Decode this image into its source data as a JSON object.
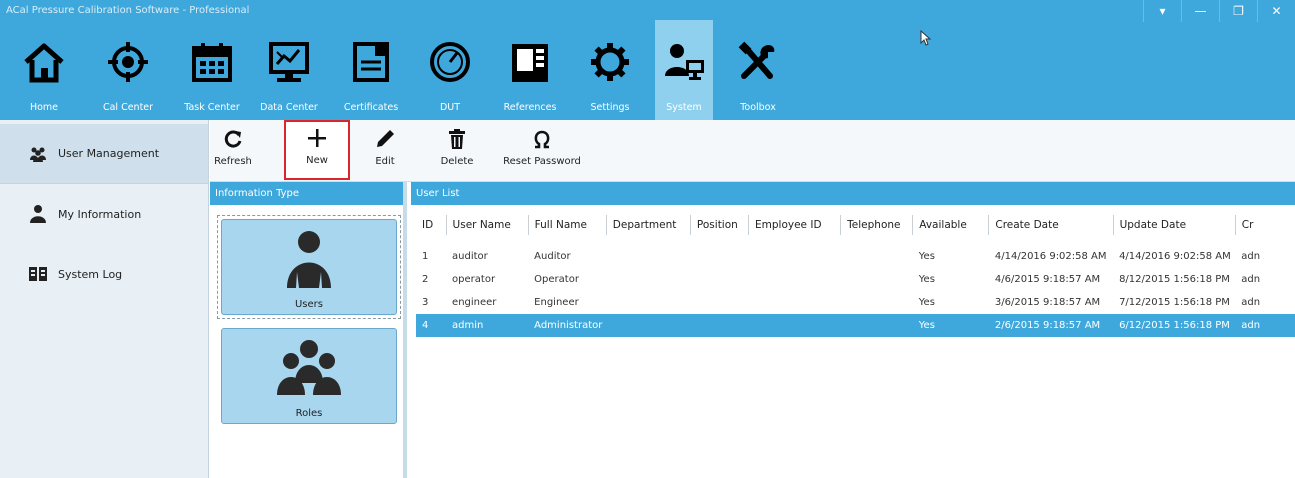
{
  "window": {
    "title": "ACal Pressure Calibration Software - Professional",
    "controls": [
      "▾",
      "—",
      "❐",
      "✕"
    ]
  },
  "nav": [
    {
      "label": "Home",
      "icon": "home-icon"
    },
    {
      "label": "Cal Center",
      "icon": "crosshair-icon"
    },
    {
      "label": "Task Center",
      "icon": "calendar-icon"
    },
    {
      "label": "Data Center",
      "icon": "chart-monitor-icon"
    },
    {
      "label": "Certificates",
      "icon": "certificate-icon"
    },
    {
      "label": "DUT",
      "icon": "gauge-icon"
    },
    {
      "label": "References",
      "icon": "reference-device-icon"
    },
    {
      "label": "Settings",
      "icon": "gear-icon"
    },
    {
      "label": "System",
      "icon": "user-computer-icon"
    },
    {
      "label": "Toolbox",
      "icon": "tools-icon"
    }
  ],
  "left_nav": [
    {
      "label": "User Management",
      "icon": "users-group-icon"
    },
    {
      "label": "My Information",
      "icon": "user-icon"
    },
    {
      "label": "System Log",
      "icon": "log-icon"
    }
  ],
  "toolbar": {
    "refresh": "Refresh",
    "new": "New",
    "edit": "Edit",
    "delete": "Delete",
    "reset_password": "Reset Password"
  },
  "info_panel": {
    "header": "Information Type",
    "users": "Users",
    "roles": "Roles"
  },
  "user_list": {
    "header": "User List",
    "columns": [
      "ID",
      "User Name",
      "Full Name",
      "Department",
      "Position",
      "Employee ID",
      "Telephone",
      "Available",
      "Create Date",
      "Update Date",
      "Cr"
    ],
    "rows": [
      [
        "1",
        "auditor",
        "Auditor",
        "",
        "",
        "",
        "",
        "Yes",
        "4/14/2016 9:02:58 AM",
        "4/14/2016 9:02:58 AM",
        "adn"
      ],
      [
        "2",
        "operator",
        "Operator",
        "",
        "",
        "",
        "",
        "Yes",
        "4/6/2015 9:18:57 AM",
        "8/12/2015 1:56:18 PM",
        "adn"
      ],
      [
        "3",
        "engineer",
        "Engineer",
        "",
        "",
        "",
        "",
        "Yes",
        "3/6/2015 9:18:57 AM",
        "7/12/2015 1:56:18 PM",
        "adn"
      ],
      [
        "4",
        "admin",
        "Administrator",
        "",
        "",
        "",
        "",
        "Yes",
        "2/6/2015 9:18:57 AM",
        "6/12/2015 1:56:18 PM",
        "adn"
      ]
    ]
  },
  "colors": {
    "ribbon": "#3ea8dc",
    "active_nav": "#8fd0ef",
    "selection": "#3ea8dc",
    "highlight_box": "#d9262a"
  }
}
